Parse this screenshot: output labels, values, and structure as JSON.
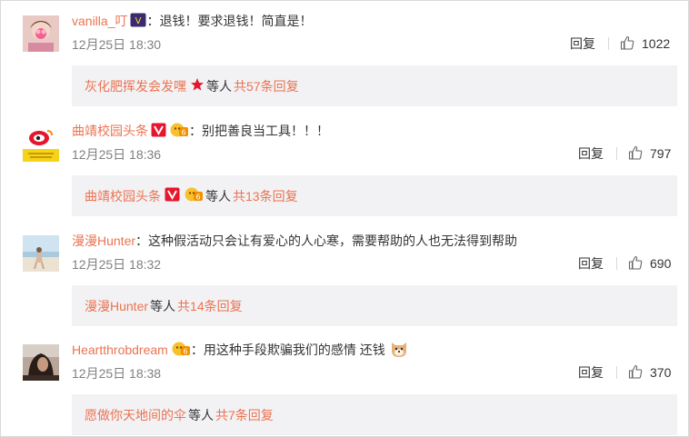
{
  "comments": [
    {
      "username": "vanilla_叮",
      "text": "退钱！要求退钱！简直是！",
      "date": "12月25日 18:30",
      "reply_label": "回复",
      "likes": "1022",
      "sub_user": "灰化肥挥发会发嘿",
      "sub_etc": "等人",
      "sub_count": "共57条回复",
      "avatar": "pink-flower-portrait",
      "badges": [
        "member-badge"
      ]
    },
    {
      "username": "曲靖校园头条",
      "text": "别把善良当工具！！！",
      "date": "12月25日 18:36",
      "reply_label": "回复",
      "likes": "797",
      "sub_user": "曲靖校园头条",
      "sub_etc": "等人",
      "sub_count": "共13条回复",
      "avatar": "weibo-logo-yellow",
      "badges": [
        "verified-v-badge",
        "fan-badge"
      ]
    },
    {
      "username": "漫漫Hunter",
      "text": "这种假活动只会让有爱心的人心寒，需要帮助的人也无法得到帮助",
      "date": "12月25日 18:32",
      "reply_label": "回复",
      "likes": "690",
      "sub_user": "漫漫Hunter",
      "sub_etc": "等人",
      "sub_count": "共14条回复",
      "avatar": "beach-photo"
    },
    {
      "username": "Heartthrobdream",
      "text": "用这种手段欺骗我们的感情 还钱",
      "date": "12月25日 18:38",
      "reply_label": "回复",
      "likes": "370",
      "sub_user": "愿做你天地间的伞",
      "sub_etc": "等人",
      "sub_count": "共7条回复",
      "avatar": "dark-portrait",
      "badges": [
        "fan-badge"
      ]
    }
  ],
  "colors": {
    "accent": "#eb7350",
    "text": "#333333",
    "meta": "#808080",
    "sub_bg": "#f2f2f5",
    "verified_red": "#e6162d"
  }
}
